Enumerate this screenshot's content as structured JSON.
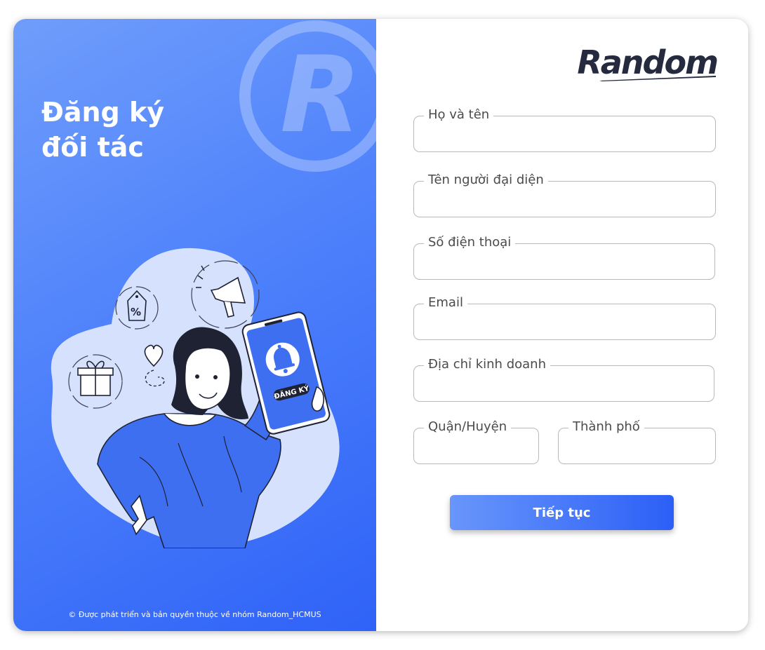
{
  "left_panel": {
    "title": "Đăng ký\nđối tác",
    "copyright": "© Được phát triển và bản quyền thuộc về nhóm Random_HCMUS",
    "watermark_letter": "R",
    "phone_badge": "ĐĂNG KÝ"
  },
  "brand": {
    "logo_text": "Random"
  },
  "form": {
    "full_name": {
      "label": "Họ và tên",
      "value": ""
    },
    "representative": {
      "label": "Tên người đại diện",
      "value": ""
    },
    "phone": {
      "label": "Số điện thoại",
      "value": ""
    },
    "email": {
      "label": "Email",
      "value": ""
    },
    "business_address": {
      "label": "Địa chỉ kinh doanh",
      "value": ""
    },
    "district": {
      "label": "Quận/Huyện",
      "value": ""
    },
    "city": {
      "label": "Thành phố",
      "value": ""
    },
    "submit_label": "Tiếp tục"
  },
  "colors": {
    "primary_blue": "#2f62f7",
    "gradient_light": "#6f9dfb",
    "logo_dark": "#262a3f"
  },
  "icons": [
    "percent-tag-icon",
    "megaphone-icon",
    "gift-box-icon",
    "heart-icon",
    "bell-icon"
  ]
}
